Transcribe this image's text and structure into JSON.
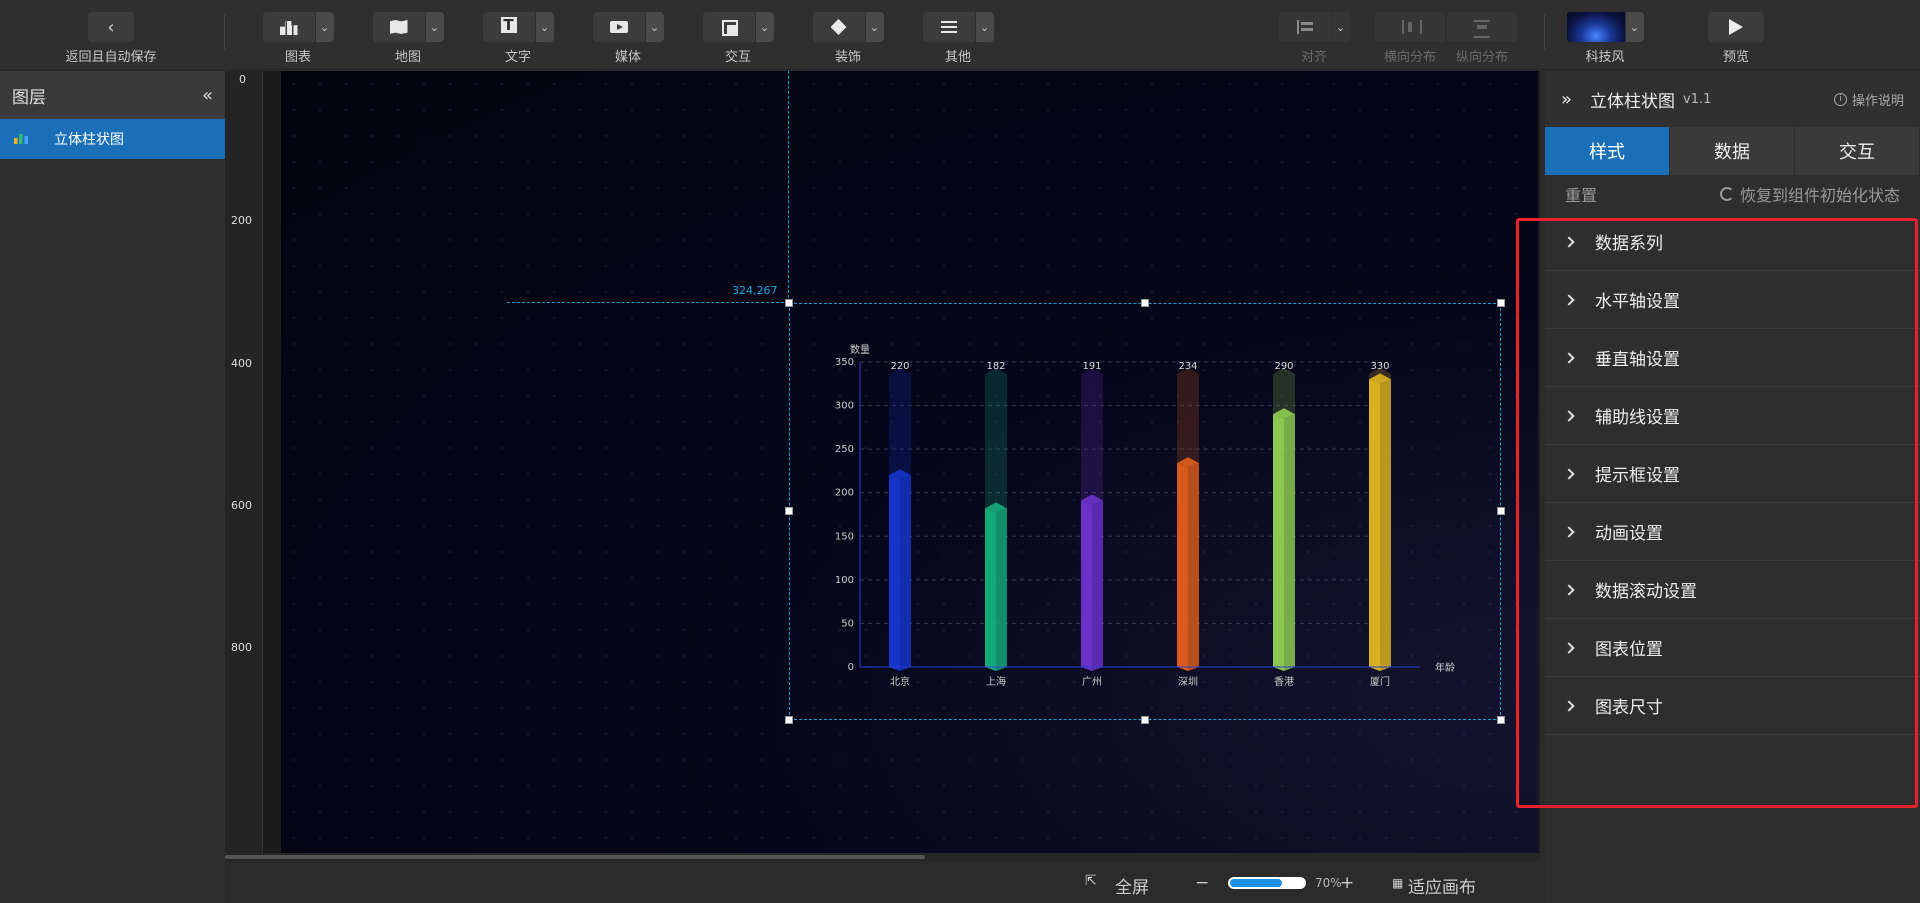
{
  "toolbar": {
    "back_label": "返回且自动保存",
    "groups": [
      {
        "label": "图表",
        "icon": "chart-icon"
      },
      {
        "label": "地图",
        "icon": "map-icon"
      },
      {
        "label": "文字",
        "icon": "text-icon"
      },
      {
        "label": "媒体",
        "icon": "media-icon"
      },
      {
        "label": "交互",
        "icon": "interaction-icon"
      },
      {
        "label": "装饰",
        "icon": "decoration-icon"
      },
      {
        "label": "其他",
        "icon": "other-icon"
      }
    ],
    "align_label": "对齐",
    "hdist_label": "横向分布",
    "vdist_label": "纵向分布",
    "theme_label": "科技风",
    "preview_label": "预览"
  },
  "layers": {
    "title": "图层",
    "items": [
      {
        "label": "立体柱状图"
      }
    ]
  },
  "ruler": {
    "marks": [
      "0",
      "200",
      "400",
      "600",
      "800"
    ]
  },
  "canvas": {
    "coord_readout": "324,267"
  },
  "chart_data": {
    "type": "bar",
    "ylabel": "数量",
    "xlabel": "年龄",
    "ylim": [
      0,
      350
    ],
    "yticks": [
      0,
      50,
      100,
      150,
      200,
      250,
      300,
      350
    ],
    "categories": [
      "北京",
      "上海",
      "广州",
      "深圳",
      "香港",
      "厦门"
    ],
    "values": [
      220,
      182,
      191,
      234,
      290,
      330
    ],
    "colors": [
      "#1434c8",
      "#14a878",
      "#6a30c8",
      "#d85a1c",
      "#8cc850",
      "#d8b020"
    ],
    "grid": true
  },
  "status": {
    "fullscreen_label": "全屏",
    "zoom_minus": "−",
    "zoom_plus": "+",
    "zoom_percent": 70,
    "zoom_text": "70%",
    "fit_label": "适应画布"
  },
  "props": {
    "title": "立体柱状图",
    "version": "v1.1",
    "help_label": "操作说明",
    "tabs": [
      {
        "label": "样式"
      },
      {
        "label": "数据"
      },
      {
        "label": "交互"
      }
    ],
    "reset_label": "重置",
    "restore_label": "恢复到组件初始化状态",
    "sections": [
      {
        "label": "数据系列"
      },
      {
        "label": "水平轴设置"
      },
      {
        "label": "垂直轴设置"
      },
      {
        "label": "辅助线设置"
      },
      {
        "label": "提示框设置"
      },
      {
        "label": "动画设置"
      },
      {
        "label": "数据滚动设置"
      },
      {
        "label": "图表位置"
      },
      {
        "label": "图表尺寸"
      }
    ]
  }
}
